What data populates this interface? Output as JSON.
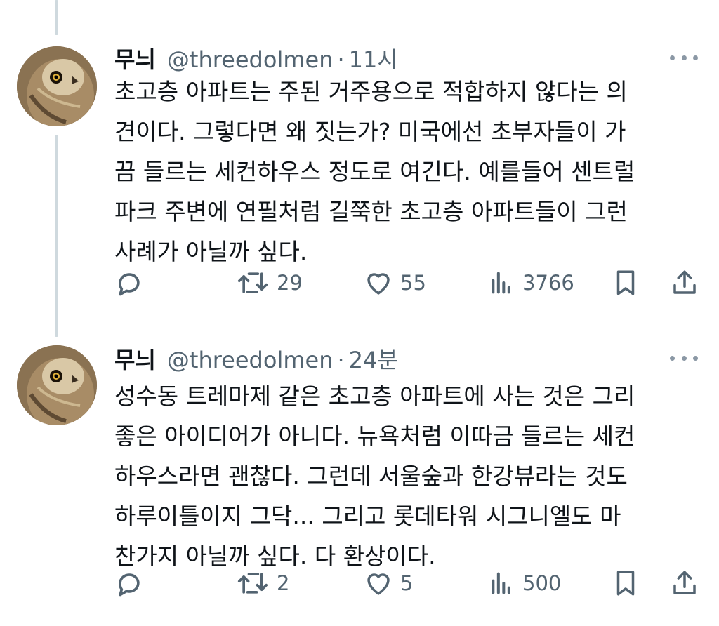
{
  "tweets": [
    {
      "name": "무늬",
      "handle": "@threedolmen",
      "separator": "·",
      "time": "11시",
      "lines": [
        "초고층 아파트는 주된 거주용으로 적합하지 않다는 의",
        "견이다. 그렇다면 왜 짓는가? 미국에선 초부자들이 가",
        "끔 들르는 세컨하우스 정도로 여긴다. 예를들어 센트럴",
        "파크 주변에 연필처럼 길쭉한 초고층 아파트들이 그런",
        "사례가 아닐까 싶다."
      ],
      "actions": {
        "reply": "",
        "retweets": "29",
        "likes": "55",
        "views": "3766"
      }
    },
    {
      "name": "무늬",
      "handle": "@threedolmen",
      "separator": "·",
      "time": "24분",
      "lines": [
        "성수동 트레마제 같은 초고층 아파트에 사는 것은 그리",
        "좋은 아이디어가 아니다. 뉴욕처럼 이따금 들르는 세컨",
        "하우스라면 괜찮다. 그런데 서울숲과 한강뷰라는 것도",
        "하루이틀이지 그닥... 그리고 롯데타워 시그니엘도 마",
        "찬가지 아닐까 싶다. 다 환상이다."
      ],
      "actions": {
        "reply": "",
        "retweets": "2",
        "likes": "5",
        "views": "500"
      }
    }
  ],
  "icons": {
    "reply": "reply-icon",
    "retweet": "retweet-icon",
    "like": "heart-icon",
    "views": "views-icon",
    "bookmark": "bookmark-icon",
    "share": "share-icon",
    "more": "more-icon"
  },
  "colors": {
    "text": "#0f1419",
    "secondary": "#536471",
    "thread_line": "#cfd9de"
  }
}
